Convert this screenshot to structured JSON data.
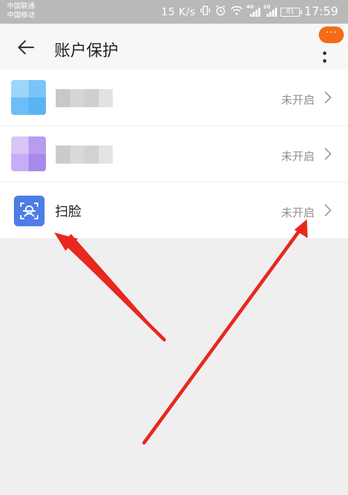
{
  "status_bar": {
    "carrier_1": "中国联通",
    "carrier_2": "中国移动",
    "net_speed": "15 K/s",
    "battery": "81",
    "time": "17:59",
    "signal_tag_1": "4G",
    "signal_tag_2": "2G"
  },
  "header": {
    "title": "账户保护",
    "badge": "···"
  },
  "list": {
    "items": [
      {
        "label": "",
        "status": "未开启",
        "icon": "blurred-app-icon"
      },
      {
        "label": "",
        "status": "未开启",
        "icon": "blurred-app-icon"
      },
      {
        "label": "扫脸",
        "status": "未开启",
        "icon": "face-scan-icon"
      }
    ]
  },
  "colors": {
    "accent_badge": "#f56b1a",
    "face_icon": "#4e7ce8",
    "arrow": "#e8281e"
  }
}
